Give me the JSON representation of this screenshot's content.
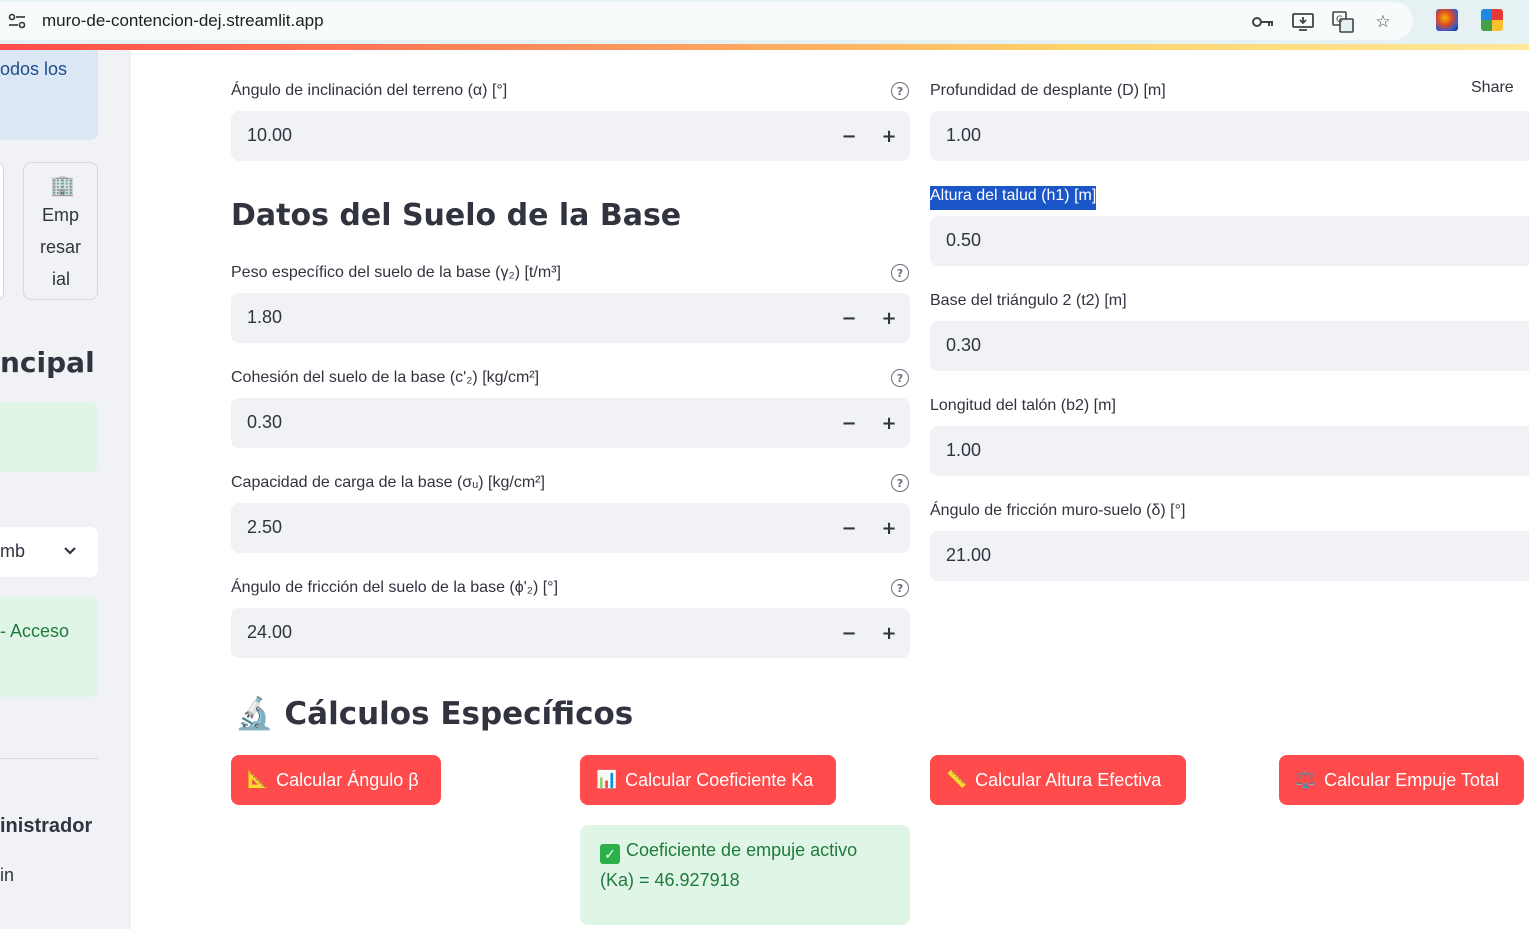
{
  "browser": {
    "url": "muro-de-contencion-dej.streamlit.app"
  },
  "sidebar": {
    "top_text": "odos los",
    "card_icon": "🏢",
    "card_lines": [
      "Emp",
      "resar",
      "ial"
    ],
    "section_heading": "ncipal",
    "select_value": "mb",
    "access_text": "- Acceso",
    "admin_heading": "inistrador",
    "admin_sub": "in"
  },
  "header": {
    "share_label": "Share"
  },
  "left_column": {
    "field_alpha": {
      "label": "Ángulo de inclinación del terreno (α) [°]",
      "value": "10.00"
    },
    "section_title": "Datos del Suelo de la Base",
    "field_gamma2": {
      "label": "Peso específico del suelo de la base (γ₂) [t/m³]",
      "value": "1.80"
    },
    "field_c2": {
      "label": "Cohesión del suelo de la base (c'₂) [kg/cm²]",
      "value": "0.30"
    },
    "field_sigma": {
      "label": "Capacidad de carga de la base (σᵤ) [kg/cm²]",
      "value": "2.50"
    },
    "field_phi2": {
      "label": "Ángulo de fricción del suelo de la base (ϕ'₂) [°]",
      "value": "24.00"
    }
  },
  "right_column": {
    "field_D": {
      "label": "Profundidad de desplante (D) [m]",
      "value": "1.00"
    },
    "field_h1": {
      "label": "Altura del talud (h1) [m]",
      "value": "0.50"
    },
    "field_t2": {
      "label": "Base del triángulo 2 (t2) [m]",
      "value": "0.30"
    },
    "field_b2": {
      "label": "Longitud del talón (b2) [m]",
      "value": "1.00"
    },
    "field_delta": {
      "label": "Ángulo de fricción muro-suelo (δ) [°]",
      "value": "21.00"
    }
  },
  "calculations": {
    "icon": "🔬",
    "title": "Cálculos Específicos",
    "buttons": [
      {
        "icon": "📐",
        "label": "Calcular Ángulo β"
      },
      {
        "icon": "📊",
        "label": "Calcular Coeficiente Ka"
      },
      {
        "icon": "📏",
        "label": "Calcular Altura Efectiva"
      },
      {
        "icon": "⚖️",
        "label": "Calcular Empuje Total"
      }
    ],
    "result_line1": "Coeficiente de empuje activo",
    "result_line2": "(Ka) = 46.927918"
  },
  "colors": {
    "primary": "#ff4b4b",
    "input_bg": "#f0f2f6",
    "success_bg": "#dff5e6",
    "success_text": "#1f7a3c"
  }
}
